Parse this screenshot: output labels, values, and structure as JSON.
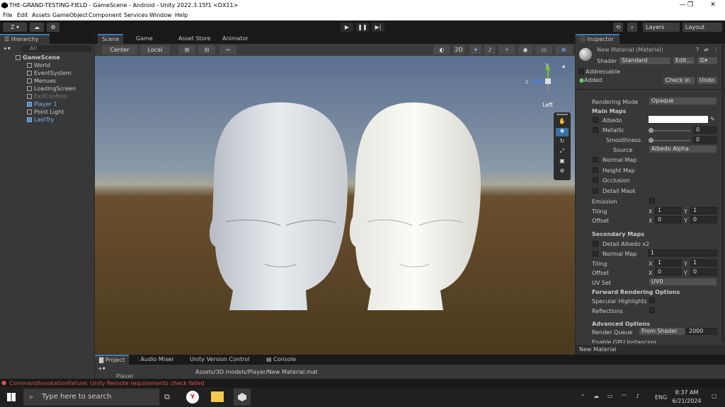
{
  "window": {
    "title": "THE-GRAND-TESTING-FIELD - GameScene - Android - Unity 2022.3.15f1 <DX11>",
    "min": "—",
    "max": "❐",
    "close": "✕"
  },
  "menu": [
    "File",
    "Edit",
    "Assets",
    "GameObject",
    "Component",
    "Services",
    "Window",
    "Help"
  ],
  "toolbar": {
    "account": "Z ▾",
    "layers": "Layers",
    "layout": "Layout"
  },
  "hierarchy": {
    "tab": "Hierarchy",
    "search_placeholder": "All",
    "items": [
      {
        "label": "GameScene",
        "indent": 0
      },
      {
        "label": "World",
        "indent": 1
      },
      {
        "label": "EventSystem",
        "indent": 1
      },
      {
        "label": "Menues",
        "indent": 1
      },
      {
        "label": "LoadingScreen",
        "indent": 1
      },
      {
        "label": "ExitConfirm",
        "indent": 1
      },
      {
        "label": "Player 1",
        "indent": 1
      },
      {
        "label": "Point Light",
        "indent": 1
      },
      {
        "label": "LastTry",
        "indent": 1
      }
    ]
  },
  "scene_tabs": [
    "Scene",
    "Game",
    "Asset Store",
    "Animator"
  ],
  "scene_toolbar": {
    "pivot": "Center",
    "space": "Local",
    "mode2d": "2D"
  },
  "gizmo": {
    "y": "y",
    "z": "z",
    "label": "Left"
  },
  "inspector": {
    "tab": "Inspector",
    "material_name": "New Material (Material)",
    "shader_label": "Shader",
    "shader_value": "Standard",
    "edit": "Edit...",
    "addressable": "Addressable",
    "added": "Added",
    "check_in": "Check in",
    "undo": "Undo",
    "rendering_mode_label": "Rendering Mode",
    "rendering_mode": "Opaque",
    "main_maps": "Main Maps",
    "albedo": "Albedo",
    "metallic": "Metallic",
    "metallic_value": "0",
    "smoothness": "Smoothness",
    "smoothness_value": "0",
    "source": "Source",
    "source_value": "Albedo Alpha",
    "normal_map": "Normal Map",
    "height_map": "Height Map",
    "occlusion": "Occlusion",
    "detail_mask": "Detail Mask",
    "emission": "Emission",
    "tiling": "Tiling",
    "offset": "Offset",
    "x": "X",
    "y": "Y",
    "tiling_x": "1",
    "tiling_y": "1",
    "offset_x": "0",
    "offset_y": "0",
    "secondary_maps": "Secondary Maps",
    "detail_albedo": "Detail Albedo x2",
    "normal_map2": "Normal Map",
    "normal_map2_value": "1",
    "tiling2_x": "1",
    "tiling2_y": "1",
    "offset2_x": "0",
    "offset2_y": "0",
    "uv_set": "UV Set",
    "uv_set_value": "UV0",
    "forward_opts": "Forward Rendering Options",
    "specular": "Specular Highlights",
    "reflections": "Reflections",
    "advanced": "Advanced Options",
    "render_queue": "Render Queue",
    "render_queue_mode": "From Shader",
    "render_queue_value": "2000",
    "gpu": "Enable GPU Instancing",
    "footer": "New Material"
  },
  "project": {
    "tabs": [
      "Project",
      "Audio Mixer",
      "Unity Version Control",
      "Console"
    ],
    "breadcrumb": "Assets/3D models/Player/New Material.mat",
    "folder": "Player"
  },
  "status": {
    "error": "CommandInvokationFailure: Unity Remote requirements check failed"
  },
  "taskbar": {
    "search_placeholder": "Type here to search",
    "lang": "ENG",
    "time": "8:37 AM",
    "date": "6/21/2024"
  }
}
